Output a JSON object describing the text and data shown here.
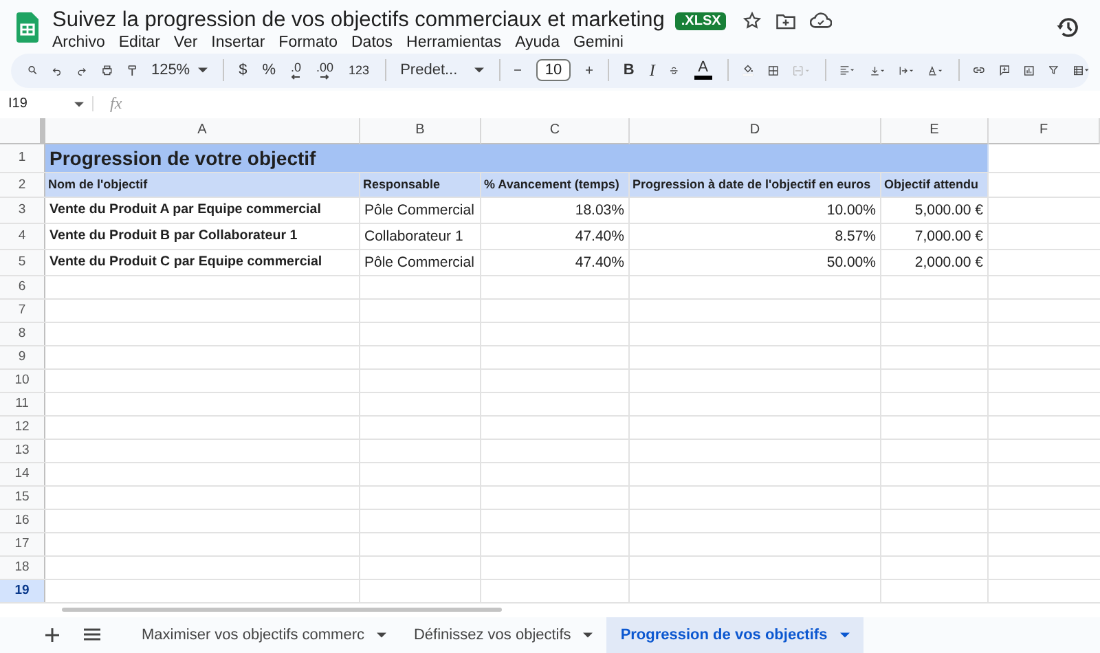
{
  "document": {
    "title": "Suivez la progression de vos objectifs commerciaux et marketing",
    "format_badge": ".XLSX"
  },
  "menu": [
    "Archivo",
    "Editar",
    "Ver",
    "Insertar",
    "Formato",
    "Datos",
    "Herramientas",
    "Ayuda",
    "Gemini"
  ],
  "toolbar": {
    "zoom": "125%",
    "currency": "$",
    "percent": "%",
    "decrease_decimals": ".0",
    "increase_decimals": ".00",
    "number_format": "123",
    "font": "Predet...",
    "font_size": "10",
    "bold": "B",
    "italic": "I",
    "text_color": "A"
  },
  "formula_bar": {
    "cell_reference": "I19",
    "fx_label": "fx"
  },
  "columns": [
    {
      "label": "A",
      "selected": false
    },
    {
      "label": "B",
      "selected": false
    },
    {
      "label": "C",
      "selected": false
    },
    {
      "label": "D",
      "selected": false
    },
    {
      "label": "E",
      "selected": false
    },
    {
      "label": "F",
      "selected": false
    }
  ],
  "rows": [
    {
      "number": "1",
      "selected": false,
      "kind": "title",
      "cells": [
        "Progression de votre objectif"
      ]
    },
    {
      "number": "2",
      "selected": false,
      "kind": "header",
      "cells": [
        "Nom de l'objectif",
        "Responsable",
        "% Avancement (temps)",
        "Progression à date de l'objectif en euros",
        "Objectif attendu"
      ]
    },
    {
      "number": "3",
      "selected": false,
      "kind": "data",
      "cells": [
        "Vente du Produit A par Equipe commercial",
        "Pôle Commercial",
        "18.03%",
        "10.00%",
        "5,000.00 €"
      ]
    },
    {
      "number": "4",
      "selected": false,
      "kind": "data",
      "cells": [
        "Vente du Produit B par Collaborateur 1",
        "Collaborateur 1",
        "47.40%",
        "8.57%",
        "7,000.00 €"
      ]
    },
    {
      "number": "5",
      "selected": false,
      "kind": "data",
      "cells": [
        "Vente du Produit C par Equipe commercial",
        "Pôle Commercial",
        "47.40%",
        "50.00%",
        "2,000.00 €"
      ]
    },
    {
      "number": "6",
      "selected": false,
      "kind": "empty",
      "cells": []
    },
    {
      "number": "7",
      "selected": false,
      "kind": "empty",
      "cells": []
    },
    {
      "number": "8",
      "selected": false,
      "kind": "empty",
      "cells": []
    },
    {
      "number": "9",
      "selected": false,
      "kind": "empty",
      "cells": []
    },
    {
      "number": "10",
      "selected": false,
      "kind": "empty",
      "cells": []
    },
    {
      "number": "11",
      "selected": false,
      "kind": "empty",
      "cells": []
    },
    {
      "number": "12",
      "selected": false,
      "kind": "empty",
      "cells": []
    },
    {
      "number": "13",
      "selected": false,
      "kind": "empty",
      "cells": []
    },
    {
      "number": "14",
      "selected": false,
      "kind": "empty",
      "cells": []
    },
    {
      "number": "15",
      "selected": false,
      "kind": "empty",
      "cells": []
    },
    {
      "number": "16",
      "selected": false,
      "kind": "empty",
      "cells": []
    },
    {
      "number": "17",
      "selected": false,
      "kind": "empty",
      "cells": []
    },
    {
      "number": "18",
      "selected": false,
      "kind": "empty",
      "cells": []
    },
    {
      "number": "19",
      "selected": true,
      "kind": "empty",
      "cells": []
    }
  ],
  "sheet_tabs": [
    {
      "label": "Maximiser vos objectifs commerc",
      "selected": false
    },
    {
      "label": "Définissez vos objectifs",
      "selected": false
    },
    {
      "label": "Progression de vos objectifs",
      "selected": true
    }
  ]
}
